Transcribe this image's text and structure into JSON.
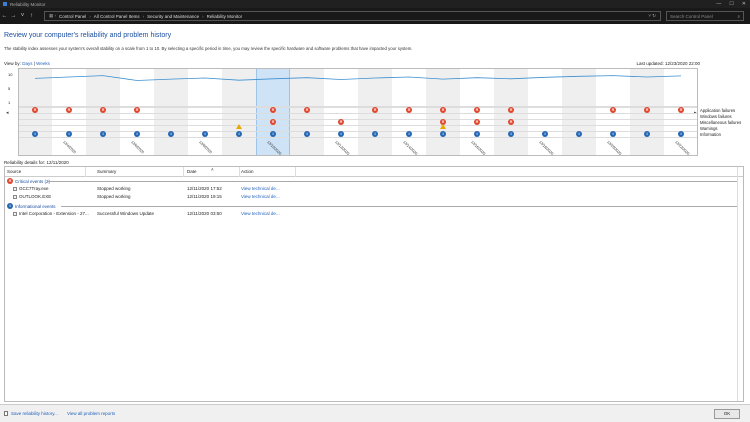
{
  "window": {
    "title": "Reliability Monitor",
    "controls": [
      "—",
      "☐",
      "✕"
    ]
  },
  "address": {
    "nav": [
      "←",
      "→",
      "˅",
      "↑"
    ],
    "crumbs": [
      "Control Panel",
      "All Control Panel Items",
      "Security and Maintenance",
      "Reliability Monitor"
    ],
    "search_placeholder": "Search Control Panel"
  },
  "header": {
    "title": "Review your computer's reliability and problem history",
    "description": "The stability index assesses your system's overall stability on a scale from 1 to 10. By selecting a specific period in time, you may review the specific hardware and software problems that have impacted your system."
  },
  "viewby": {
    "label": "View by:",
    "days": "Days",
    "sep": "|",
    "weeks": "Weeks"
  },
  "last_updated": "Last updated: 12/23/2020 22:00",
  "chart_data": {
    "type": "line",
    "y_ticks": [
      "10",
      "5",
      "1"
    ],
    "ylim": [
      1,
      10
    ],
    "selected_index": 7,
    "row_labels": [
      "Application failures",
      "Windows failures",
      "Miscellaneous failures",
      "Warnings",
      "Information"
    ],
    "date_labels": [
      "12/4/2020",
      "12/6/2020",
      "12/8/2020",
      "12/10/2020",
      "12/12/2020",
      "12/14/2020",
      "12/16/2020",
      "12/18/2020",
      "12/20/2020",
      "12/22/2020"
    ],
    "stability": [
      8.2,
      8.6,
      9.0,
      7.6,
      8.0,
      8.3,
      7.7,
      8.1,
      8.4,
      7.9,
      8.3,
      8.6,
      8.0,
      8.4,
      8.1,
      8.5,
      8.8,
      9.0,
      8.6,
      8.9
    ],
    "app_failures": [
      1,
      1,
      1,
      1,
      0,
      0,
      0,
      1,
      1,
      0,
      1,
      1,
      1,
      1,
      1,
      0,
      0,
      1,
      1,
      1
    ],
    "misc_failures": [
      0,
      0,
      0,
      0,
      0,
      0,
      0,
      1,
      0,
      1,
      0,
      0,
      1,
      1,
      1,
      0,
      0,
      0,
      0,
      0
    ],
    "warnings": [
      0,
      0,
      0,
      0,
      0,
      0,
      1,
      0,
      0,
      0,
      0,
      0,
      1,
      0,
      0,
      0,
      0,
      0,
      0,
      0
    ],
    "information": [
      1,
      1,
      1,
      1,
      1,
      1,
      1,
      1,
      1,
      1,
      1,
      1,
      1,
      1,
      1,
      1,
      1,
      1,
      1,
      1
    ]
  },
  "details": {
    "title": "Reliability details for: 12/11/2020",
    "columns": [
      "Source",
      "Summary",
      "Date",
      "Action"
    ],
    "critical_group": "Critical events (2)",
    "critical_rows": [
      {
        "source": "GCC7Tray.exe",
        "summary": "Stopped working",
        "date": "12/11/2020 17:52",
        "action": "View technical de..."
      },
      {
        "source": "OUTLOOK.EXE",
        "summary": "Stopped working",
        "date": "12/11/2020 19:15",
        "action": "View technical de..."
      }
    ],
    "info_group": "Informational events",
    "info_rows": [
      {
        "source": "Intel Corporation - Extension - 27...",
        "summary": "Successful Windows Update",
        "date": "12/11/2020 03:50",
        "action": "View technical de..."
      }
    ]
  },
  "footer": {
    "save": "Save reliability history...",
    "view_all": "View all problem reports",
    "ok": "OK"
  },
  "colors": {
    "accent": "#1c4fa0",
    "error": "#e0452e",
    "info": "#2567b3",
    "warning": "#e8a800",
    "line": "#3b8fd0"
  }
}
